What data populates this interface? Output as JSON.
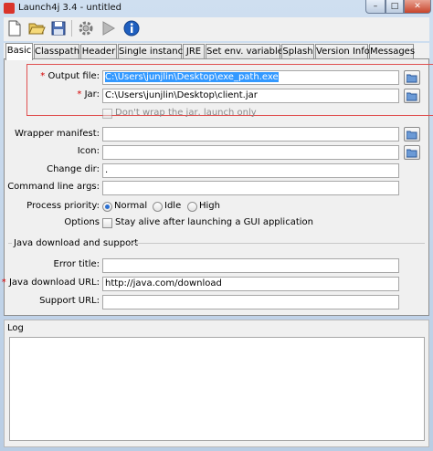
{
  "window": {
    "title": "Launch4j 3.4 - untitled",
    "minimize_glyph": "–",
    "maximize_glyph": "□",
    "close_glyph": "✕"
  },
  "toolbar": {
    "buttons": [
      {
        "name": "new",
        "icon": "new-file-icon"
      },
      {
        "name": "open",
        "icon": "open-folder-icon"
      },
      {
        "name": "save",
        "icon": "save-icon"
      },
      {
        "name": "build",
        "icon": "gear-icon"
      },
      {
        "name": "run",
        "icon": "play-icon"
      },
      {
        "name": "about",
        "icon": "info-icon"
      }
    ]
  },
  "tabs": [
    "Basic",
    "Classpath",
    "Header",
    "Single instance",
    "JRE",
    "Set env. variables",
    "Splash",
    "Version Info",
    "Messages"
  ],
  "active_tab": "Basic",
  "basic": {
    "output_file": {
      "label": "Output file:",
      "required": "*",
      "value": "C:\\Users\\junjlin\\Desktop\\exe_path.exe"
    },
    "jar": {
      "label": "Jar:",
      "required": "*",
      "value": "C:\\Users\\junjlin\\Desktop\\client.jar"
    },
    "dont_wrap": {
      "label": "Don't wrap the jar, launch only",
      "checked": false
    },
    "wrapper_manifest": {
      "label": "Wrapper manifest:",
      "value": ""
    },
    "icon": {
      "label": "Icon:",
      "value": ""
    },
    "change_dir": {
      "label": "Change dir:",
      "value": "."
    },
    "command_line_args": {
      "label": "Command line args:",
      "value": ""
    },
    "process_priority": {
      "label": "Process priority:",
      "options": [
        "Normal",
        "Idle",
        "High"
      ],
      "selected": "Normal"
    },
    "options": {
      "label": "Options",
      "stay_alive": "Stay alive after launching a GUI application",
      "checked": false
    }
  },
  "java_download": {
    "title": "Java download and support",
    "error_title": {
      "label": "Error title:",
      "value": ""
    },
    "download_url": {
      "label": "Java download URL:",
      "required": "*",
      "value": "http://java.com/download"
    },
    "support_url": {
      "label": "Support URL:",
      "value": ""
    }
  },
  "log": {
    "title": "Log",
    "content": ""
  },
  "colors": {
    "selection": "#3399ff",
    "required_star": "#d40000",
    "highlight_border": "#e05050"
  }
}
